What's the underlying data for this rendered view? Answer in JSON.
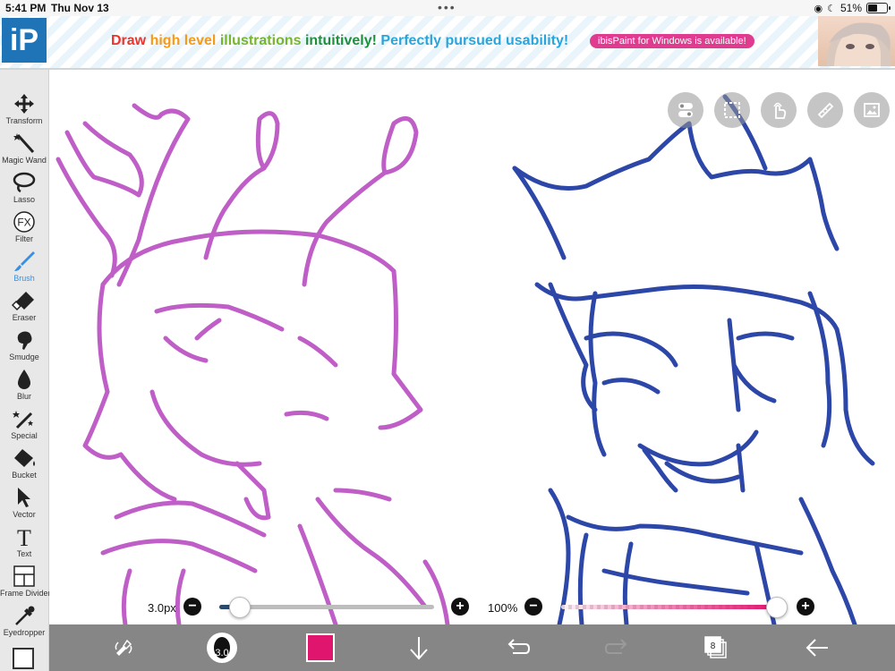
{
  "status_bar": {
    "time": "5:41 PM",
    "date": "Thu Nov 13",
    "dots": "•••",
    "battery_percent": "51%",
    "battery_level": 0.51
  },
  "banner": {
    "logo_text": "iP",
    "headline_parts": [
      {
        "text": "Draw ",
        "color": "#e8352e"
      },
      {
        "text": "high level ",
        "color": "#f59a1b"
      },
      {
        "text": "illustrations ",
        "color": "#77b52f"
      },
      {
        "text": "intuitively! ",
        "color": "#1f8f3d"
      },
      {
        "text": "Perfectly pursued usability!",
        "color": "#2aa5dc"
      }
    ],
    "pill_text": "ibisPaint for Windows is available!"
  },
  "toolbar": {
    "tools": [
      {
        "label": "Transform",
        "icon": "move-arrows-icon"
      },
      {
        "label": "Magic Wand",
        "icon": "magic-wand-icon"
      },
      {
        "label": "Lasso",
        "icon": "lasso-icon"
      },
      {
        "label": "Filter",
        "icon": "fx-icon",
        "glyph": "FX"
      },
      {
        "label": "Brush",
        "icon": "brush-icon",
        "active": true
      },
      {
        "label": "Eraser",
        "icon": "eraser-icon"
      },
      {
        "label": "Smudge",
        "icon": "smudge-icon"
      },
      {
        "label": "Blur",
        "icon": "blur-drop-icon"
      },
      {
        "label": "Special",
        "icon": "special-pen-icon"
      },
      {
        "label": "Bucket",
        "icon": "bucket-icon"
      },
      {
        "label": "Vector",
        "icon": "vector-arrow-icon"
      },
      {
        "label": "Text",
        "icon": "text-icon",
        "glyph": "T"
      },
      {
        "label": "Frame Divider",
        "icon": "frame-divider-icon"
      },
      {
        "label": "Eyedropper",
        "icon": "eyedropper-icon"
      }
    ],
    "active_color": "#3b8fe0"
  },
  "sliders": {
    "brush_size_label": "3.0px",
    "brush_size_fraction": 0.09,
    "opacity_label": "100%",
    "opacity_fraction": 1.0,
    "minus": "−",
    "plus": "+"
  },
  "bottom_bar": {
    "brush_preview_value": "3.0",
    "current_color": "#e0156e",
    "layer_count": "8"
  },
  "colors": {
    "pink_stroke": "#c05ec8",
    "blue_stroke": "#2c47a8"
  }
}
